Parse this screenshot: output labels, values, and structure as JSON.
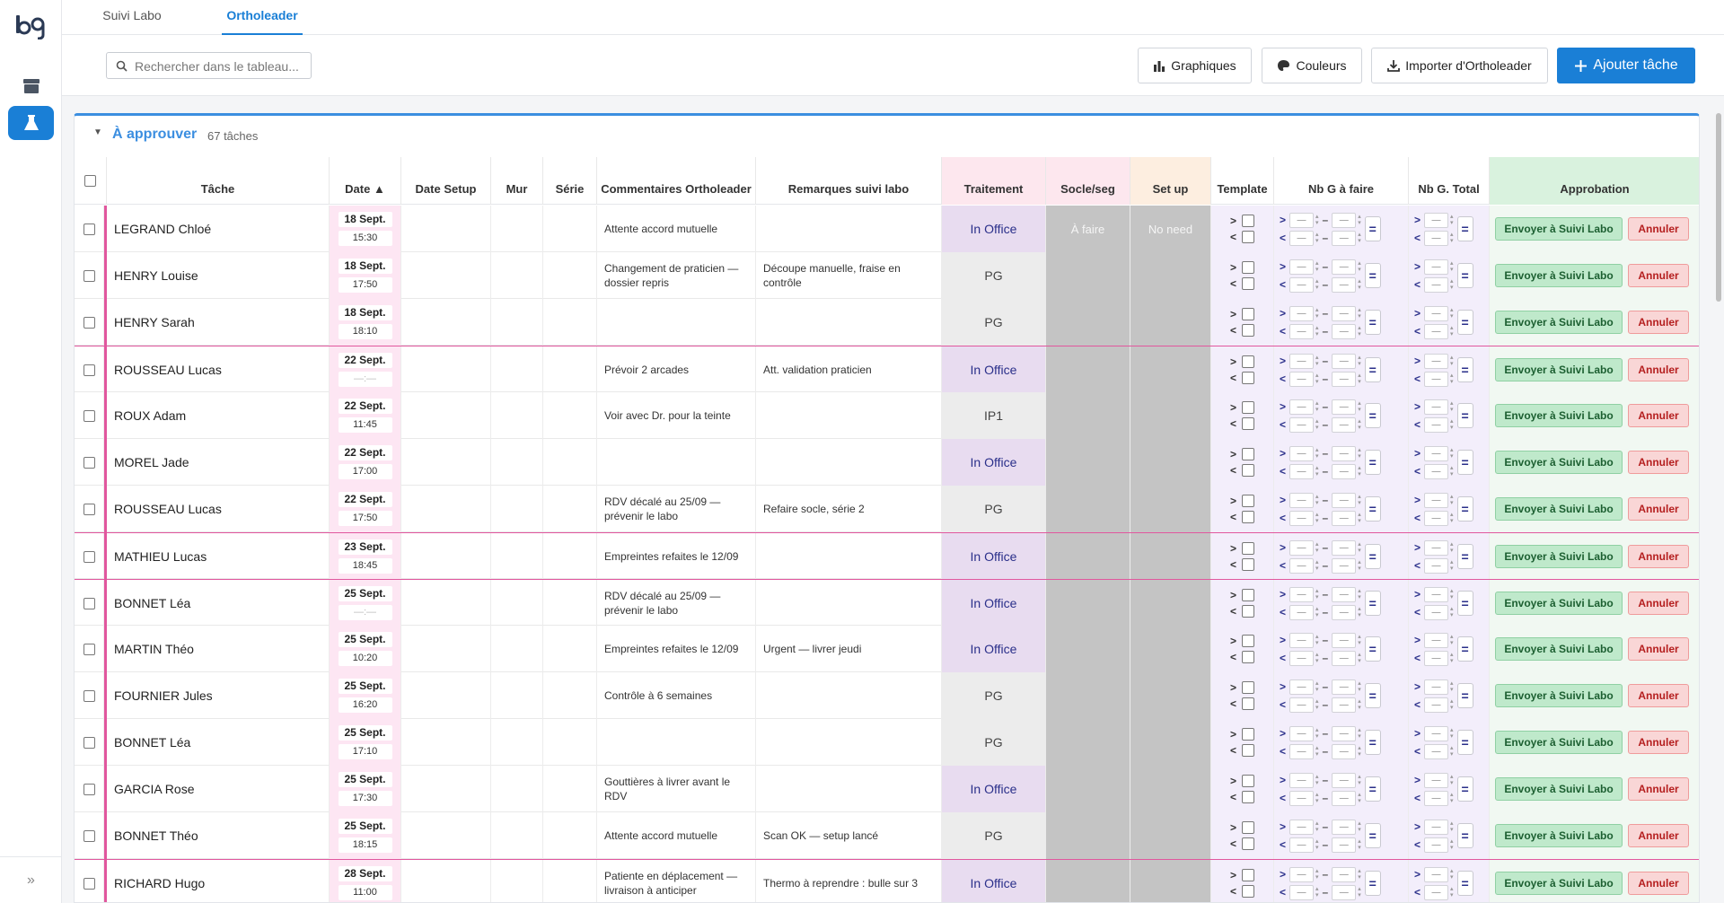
{
  "tabs": [
    {
      "label": "Suivi Labo"
    },
    {
      "label": "Ortholeader"
    }
  ],
  "search": {
    "placeholder": "Rechercher dans le tableau..."
  },
  "toolbar": {
    "charts_label": "Graphiques",
    "colors_label": "Couleurs",
    "import_label": "Importer d'Ortholeader",
    "add_label": "Ajouter tâche"
  },
  "group": {
    "title": "À approuver",
    "count": "67 tâches"
  },
  "columns": {
    "task": "Tâche",
    "date": "Date ▲",
    "date_setup": "Date Setup",
    "mur": "Mur",
    "serie": "Série",
    "comments": "Commentaires Ortholeader",
    "remarks": "Remarques suivi labo",
    "treatment": "Traitement",
    "socle": "Socle/seg",
    "setup": "Set up",
    "template": "Template",
    "nb_todo": "Nb G à faire",
    "nb_total": "Nb G. Total",
    "approval": "Approbation"
  },
  "labels": {
    "send": "Envoyer à Suivi Labo",
    "cancel": "Annuler",
    "gt": ">",
    "lt": "<",
    "eq": "=",
    "mini_placeholder": "—",
    "empty_time": "—:—",
    "socle_first": "À faire",
    "setup_first": "No need"
  },
  "rows": [
    {
      "name": "LEGRAND Chloé",
      "day": "18 Sept.",
      "time": "15:30",
      "comment": "Attente accord mutuelle",
      "remark": "",
      "treatment": "In Office"
    },
    {
      "name": "HENRY Louise",
      "day": "18 Sept.",
      "time": "17:50",
      "comment": "Changement de praticien — dossier repris",
      "remark": "Découpe manuelle, fraise en contrôle",
      "treatment": "PG"
    },
    {
      "name": "HENRY Sarah",
      "day": "18 Sept.",
      "time": "18:10",
      "comment": "",
      "remark": "",
      "treatment": "PG"
    },
    {
      "name": "ROUSSEAU Lucas",
      "day": "22 Sept.",
      "time": "—:—",
      "comment": "Prévoir 2 arcades",
      "remark": "Att. validation praticien",
      "treatment": "In Office"
    },
    {
      "name": "ROUX Adam",
      "day": "22 Sept.",
      "time": "11:45",
      "comment": "Voir avec Dr. pour la teinte",
      "remark": "",
      "treatment": "IP1"
    },
    {
      "name": "MOREL Jade",
      "day": "22 Sept.",
      "time": "17:00",
      "comment": "",
      "remark": "",
      "treatment": "In Office"
    },
    {
      "name": "ROUSSEAU Lucas",
      "day": "22 Sept.",
      "time": "17:50",
      "comment": "RDV décalé au 25/09 — prévenir le labo",
      "remark": "Refaire socle, série 2",
      "treatment": "PG"
    },
    {
      "name": "MATHIEU Lucas",
      "day": "23 Sept.",
      "time": "18:45",
      "comment": "Empreintes refaites le 12/09",
      "remark": "",
      "treatment": "In Office"
    },
    {
      "name": "BONNET Léa",
      "day": "25 Sept.",
      "time": "—:—",
      "comment": "RDV décalé au 25/09 — prévenir le labo",
      "remark": "",
      "treatment": "In Office"
    },
    {
      "name": "MARTIN Théo",
      "day": "25 Sept.",
      "time": "10:20",
      "comment": "Empreintes refaites le 12/09",
      "remark": "Urgent — livrer jeudi",
      "treatment": "In Office"
    },
    {
      "name": "FOURNIER Jules",
      "day": "25 Sept.",
      "time": "16:20",
      "comment": "Contrôle à 6 semaines",
      "remark": "",
      "treatment": "PG"
    },
    {
      "name": "BONNET Léa",
      "day": "25 Sept.",
      "time": "17:10",
      "comment": "",
      "remark": "",
      "treatment": "PG"
    },
    {
      "name": "GARCIA Rose",
      "day": "25 Sept.",
      "time": "17:30",
      "comment": "Gouttières à livrer avant le RDV",
      "remark": "",
      "treatment": "In Office"
    },
    {
      "name": "BONNET Théo",
      "day": "25 Sept.",
      "time": "18:15",
      "comment": "Attente accord mutuelle",
      "remark": "Scan OK — setup lancé",
      "treatment": "PG"
    },
    {
      "name": "RICHARD Hugo",
      "day": "28 Sept.",
      "time": "11:00",
      "comment": "Patiente en déplacement — livraison à anticiper",
      "remark": "Thermo à reprendre : bulle sur 3",
      "treatment": "In Office"
    }
  ],
  "colors": {
    "accent": "#1a7fd6",
    "date_bg": "#fde6f3",
    "office_bg": "#e8dcf0",
    "group_bar": "#e1579e"
  }
}
